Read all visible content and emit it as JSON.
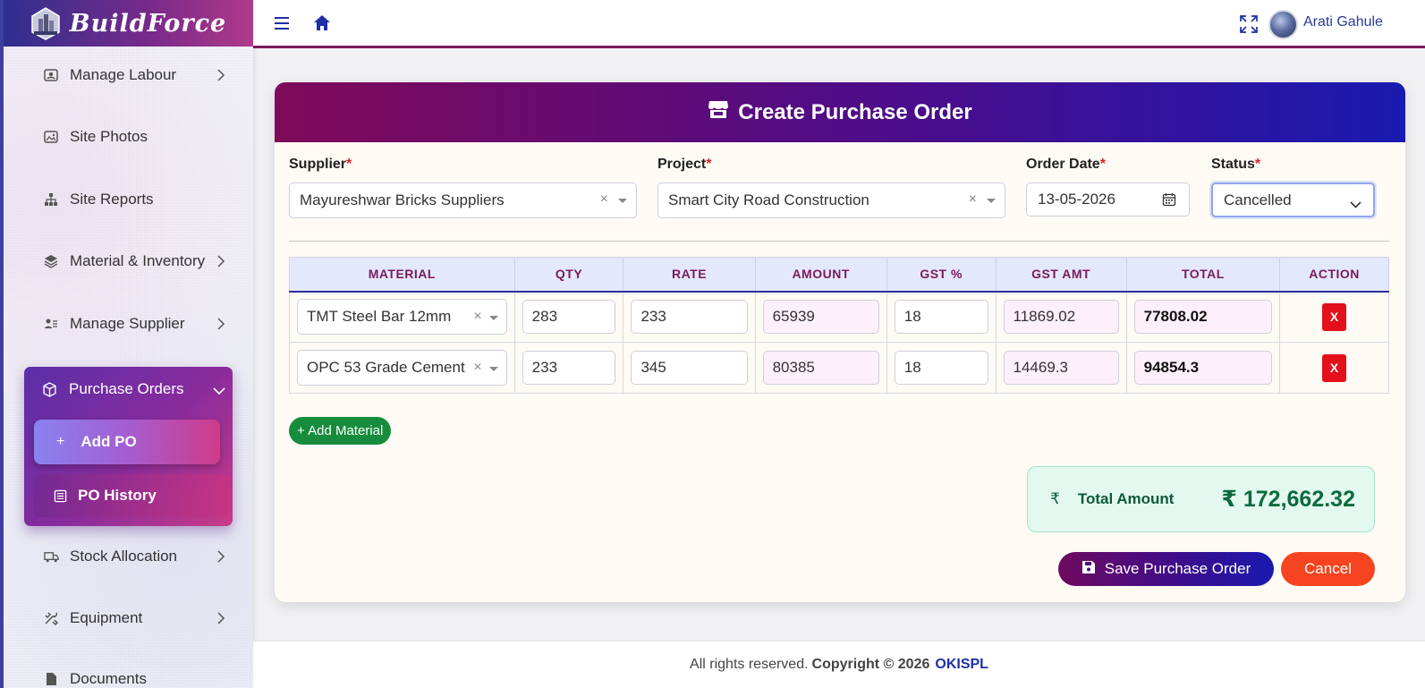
{
  "brand": {
    "name": "BuildForce"
  },
  "sidebar": {
    "items": [
      {
        "label": "Manage Labour",
        "icon": "user-badge-icon",
        "has_chevron": true
      },
      {
        "label": "Site Photos",
        "icon": "image-icon",
        "has_chevron": false
      },
      {
        "label": "Site Reports",
        "icon": "sitemap-icon",
        "has_chevron": false
      },
      {
        "label": "Material & Inventory",
        "icon": "layers-icon",
        "has_chevron": true
      },
      {
        "label": "Manage Supplier",
        "icon": "user-list-icon",
        "has_chevron": true
      },
      {
        "label": "Stock Allocation",
        "icon": "truck-icon",
        "has_chevron": true
      },
      {
        "label": "Equipment",
        "icon": "tools-icon",
        "has_chevron": true
      },
      {
        "label": "Documents",
        "icon": "file-icon",
        "has_chevron": false
      }
    ],
    "purchase_orders": {
      "label": "Purchase Orders",
      "icon": "box-icon",
      "add_label": "Add PO",
      "history_label": "PO History"
    }
  },
  "topbar": {
    "username": "Arati Gahule"
  },
  "form": {
    "title": "Create Purchase Order",
    "supplier": {
      "label": "Supplier",
      "value": "Mayureshwar Bricks Suppliers"
    },
    "project": {
      "label": "Project",
      "value": "Smart City Road Construction"
    },
    "order_date": {
      "label": "Order Date",
      "value": "13-05-2026"
    },
    "status": {
      "label": "Status",
      "value": "Cancelled"
    },
    "required_mark": "*"
  },
  "table": {
    "headers": [
      "MATERIAL",
      "QTY",
      "RATE",
      "AMOUNT",
      "GST %",
      "GST AMT",
      "TOTAL",
      "ACTION"
    ],
    "rows": [
      {
        "material": "TMT Steel Bar 12mm",
        "qty": "283",
        "rate": "233",
        "amount": "65939",
        "gst_pct": "18",
        "gst_amt": "11869.02",
        "total": "77808.02",
        "action": "X"
      },
      {
        "material": "OPC 53 Grade Cement",
        "qty": "233",
        "rate": "345",
        "amount": "80385",
        "gst_pct": "18",
        "gst_amt": "14469.3",
        "total": "94854.3",
        "action": "X"
      }
    ]
  },
  "actions": {
    "add_material": "+ Add Material",
    "save": "Save Purchase Order",
    "cancel": "Cancel"
  },
  "summary": {
    "currency_symbol": "₹",
    "total_label": "Total Amount",
    "total_value": "₹ 172,662.32"
  },
  "footer": {
    "text": "All rights reserved.",
    "copyright": "Copyright © 2026",
    "org": "OKISPL"
  },
  "colors": {
    "brand_gradient_start": "#7f0a59",
    "brand_gradient_end": "#1a1ab0",
    "table_header_text": "#7b1a5e",
    "add_button": "#178c3c",
    "delete_button": "#e3101c",
    "cancel_button": "#f5441f",
    "total_text": "#0e6a3e"
  }
}
